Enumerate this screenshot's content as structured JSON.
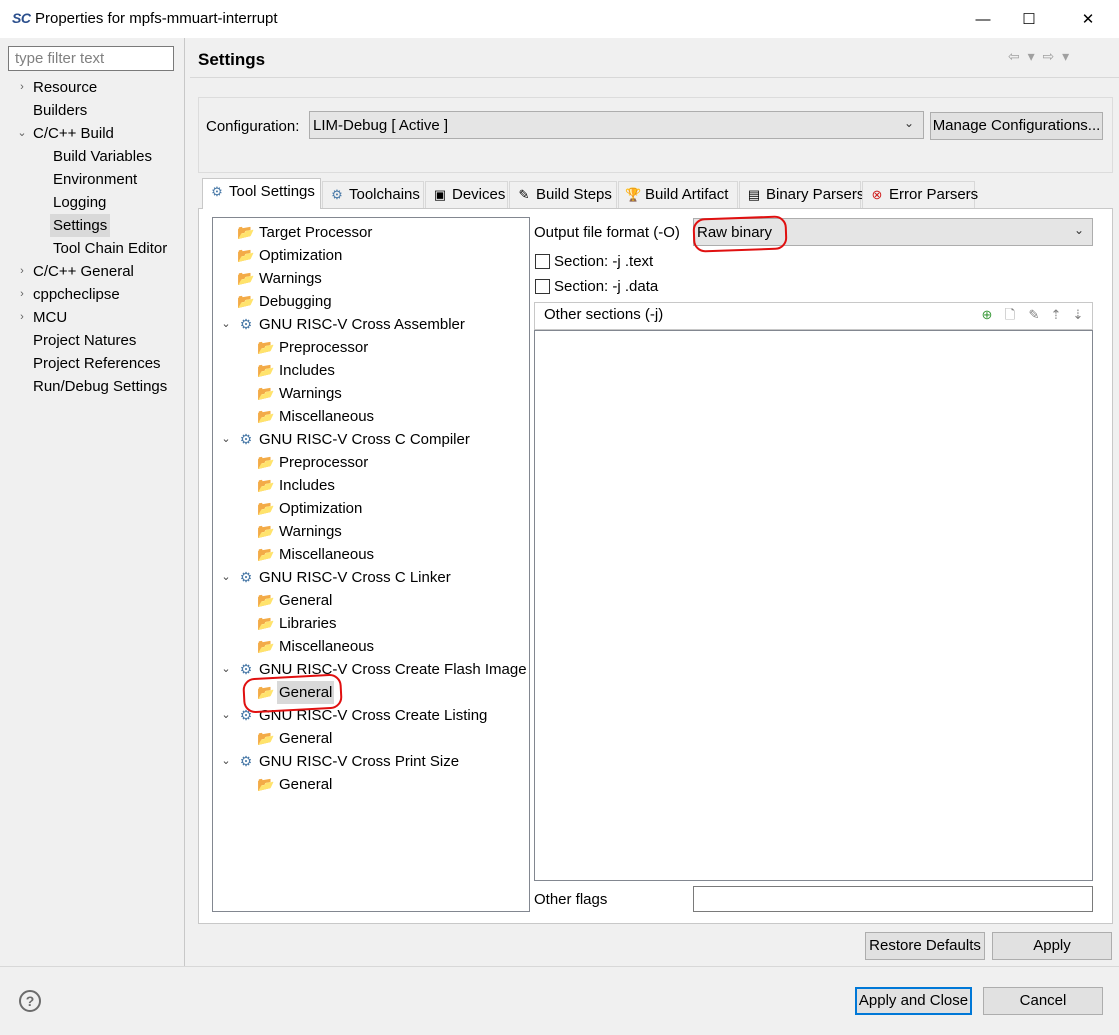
{
  "window": {
    "logo": "SC",
    "title": "Properties for mpfs-mmuart-interrupt",
    "minimize_glyph": "—",
    "maximize_glyph": "☐",
    "close_glyph": "✕"
  },
  "filter": {
    "placeholder": "type filter text",
    "value": ""
  },
  "nav": {
    "items": [
      {
        "label": "Resource",
        "expander": "›"
      },
      {
        "label": "Builders",
        "expander": ""
      },
      {
        "label": "C/C++ Build",
        "expander": "⌄"
      },
      {
        "label": "Build Variables",
        "expander": ""
      },
      {
        "label": "Environment",
        "expander": ""
      },
      {
        "label": "Logging",
        "expander": ""
      },
      {
        "label": "Settings",
        "expander": "",
        "selected": true
      },
      {
        "label": "Tool Chain Editor",
        "expander": ""
      },
      {
        "label": "C/C++ General",
        "expander": "›"
      },
      {
        "label": "cppcheclipse",
        "expander": "›"
      },
      {
        "label": "MCU",
        "expander": "›"
      },
      {
        "label": "Project Natures",
        "expander": ""
      },
      {
        "label": "Project References",
        "expander": ""
      },
      {
        "label": "Run/Debug Settings",
        "expander": ""
      }
    ]
  },
  "header": {
    "title": "Settings",
    "nav_arrows": "⇦ ▾ ⇨ ▾"
  },
  "configuration": {
    "label": "Configuration:",
    "value": "LIM-Debug  [ Active ]",
    "manage_button": "Manage Configurations..."
  },
  "tabs": [
    {
      "label": "Tool Settings",
      "icon": "tool-settings-icon",
      "glyph": "⚙",
      "active": true
    },
    {
      "label": "Toolchains",
      "icon": "toolchains-icon",
      "glyph": "⚙"
    },
    {
      "label": "Devices",
      "icon": "chip-icon",
      "glyph": "▣"
    },
    {
      "label": "Build Steps",
      "icon": "build-steps-icon",
      "glyph": "✎"
    },
    {
      "label": "Build Artifact",
      "icon": "trophy-icon",
      "glyph": "🏆"
    },
    {
      "label": "Binary Parsers",
      "icon": "binary-icon",
      "glyph": "▤"
    },
    {
      "label": "Error Parsers",
      "icon": "error-icon",
      "glyph": "⊗"
    }
  ],
  "tool_tree": [
    {
      "label": "Target Processor",
      "type": "folder"
    },
    {
      "label": "Optimization",
      "type": "folder"
    },
    {
      "label": "Warnings",
      "type": "folder"
    },
    {
      "label": "Debugging",
      "type": "folder"
    },
    {
      "label": "GNU RISC-V Cross Assembler",
      "type": "tool"
    },
    {
      "label": "Preprocessor",
      "type": "folder"
    },
    {
      "label": "Includes",
      "type": "folder"
    },
    {
      "label": "Warnings",
      "type": "folder"
    },
    {
      "label": "Miscellaneous",
      "type": "folder"
    },
    {
      "label": "GNU RISC-V Cross C Compiler",
      "type": "tool"
    },
    {
      "label": "Preprocessor",
      "type": "folder"
    },
    {
      "label": "Includes",
      "type": "folder"
    },
    {
      "label": "Optimization",
      "type": "folder"
    },
    {
      "label": "Warnings",
      "type": "folder"
    },
    {
      "label": "Miscellaneous",
      "type": "folder"
    },
    {
      "label": "GNU RISC-V Cross C Linker",
      "type": "tool"
    },
    {
      "label": "General",
      "type": "folder"
    },
    {
      "label": "Libraries",
      "type": "folder"
    },
    {
      "label": "Miscellaneous",
      "type": "folder"
    },
    {
      "label": "GNU RISC-V Cross Create Flash Image",
      "type": "tool"
    },
    {
      "label": "General",
      "type": "folder",
      "selected": true
    },
    {
      "label": "GNU RISC-V Cross Create Listing",
      "type": "tool"
    },
    {
      "label": "General",
      "type": "folder"
    },
    {
      "label": "GNU RISC-V Cross Print Size",
      "type": "tool"
    },
    {
      "label": "General",
      "type": "folder"
    }
  ],
  "settings": {
    "output_format_label": "Output file format (-O)",
    "output_format_value": "Raw binary",
    "section_text_label": "Section: -j .text",
    "section_data_label": "Section: -j .data",
    "other_sections_label": "Other sections (-j)",
    "other_flags_label": "Other flags",
    "other_flags_value": ""
  },
  "buttons": {
    "restore_defaults": "Restore Defaults",
    "apply": "Apply",
    "apply_close": "Apply and Close",
    "cancel": "Cancel",
    "help": "?"
  },
  "colors": {
    "selection": "#d9d9d9",
    "annotation": "#e01010",
    "default_button_border": "#0078d7"
  }
}
